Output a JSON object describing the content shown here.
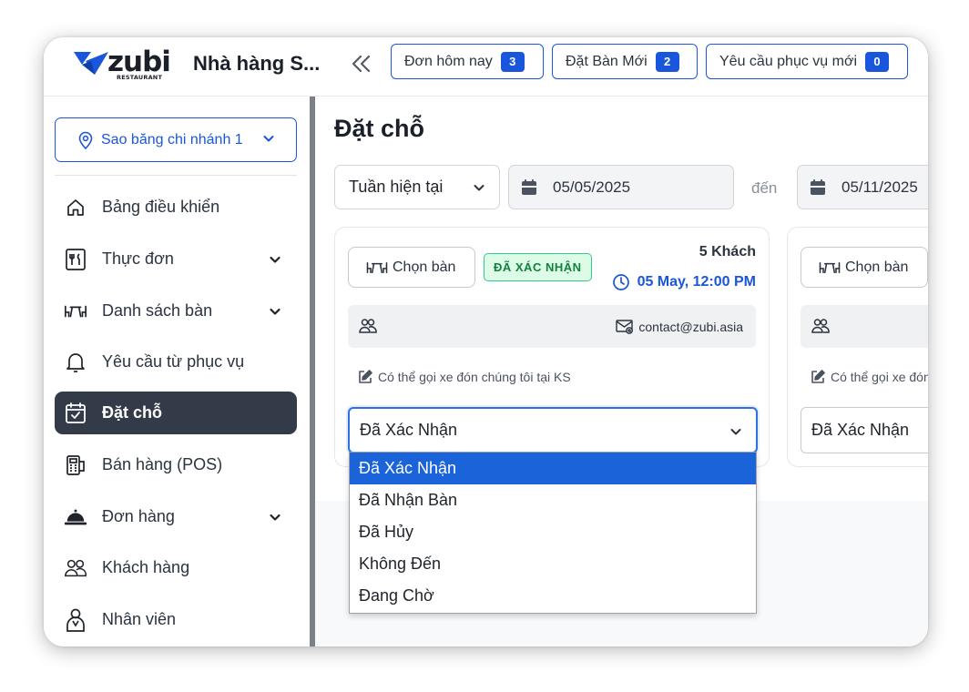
{
  "header": {
    "logo_text": "zubi",
    "logo_subtext": "RESTAURANT",
    "restaurant_name": "Nhà hàng S...",
    "buttons": [
      {
        "label": "Đơn hôm nay",
        "count": "3"
      },
      {
        "label": "Đặt Bàn Mới",
        "count": "2"
      },
      {
        "label": "Yêu cầu phục vụ mới",
        "count": "0"
      }
    ]
  },
  "sidebar": {
    "branch": "Sao băng chi nhánh 1",
    "items": [
      {
        "label": "Bảng điều khiển",
        "icon": "home-icon"
      },
      {
        "label": "Thực đơn",
        "icon": "menu-book-icon",
        "expandable": true
      },
      {
        "label": "Danh sách bàn",
        "icon": "table-icon",
        "expandable": true
      },
      {
        "label": "Yêu cầu từ phục vụ",
        "icon": "bell-icon"
      },
      {
        "label": "Đặt chỗ",
        "icon": "calendar-check-icon",
        "active": true
      },
      {
        "label": "Bán hàng (POS)",
        "icon": "pos-terminal-icon"
      },
      {
        "label": "Đơn hàng",
        "icon": "service-bell-icon",
        "expandable": true
      },
      {
        "label": "Khách hàng",
        "icon": "users-icon"
      },
      {
        "label": "Nhân viên",
        "icon": "staff-icon"
      }
    ]
  },
  "main": {
    "title": "Đặt chỗ",
    "period": "Tuần hiện tại",
    "date_from": "05/05/2025",
    "to_label": "đến",
    "date_to": "05/11/2025",
    "cards": [
      {
        "choose_table": "Chọn bàn",
        "status_badge": "ĐÃ XÁC NHẬN",
        "guests": "5 Khách",
        "datetime": "05 May, 12:00 PM",
        "email": "contact@zubi.asia",
        "note": "Có thể gọi xe đón chúng tôi tại KS",
        "status_value": "Đã Xác Nhận"
      },
      {
        "choose_table": "Chọn bàn",
        "note": "Có thể gọi xe đón",
        "status_value": "Đã Xác Nhận"
      }
    ],
    "status_options": [
      "Đã Xác Nhận",
      "Đã Nhận Bàn",
      "Đã Hủy",
      "Không Đến",
      "Đang Chờ"
    ],
    "selected_option": "Đã Xác Nhận"
  },
  "colors": {
    "primary": "#1a56db",
    "sidebar_active": "#333b48",
    "badge_green_bg": "#dcfce7",
    "badge_green_text": "#15803d"
  }
}
